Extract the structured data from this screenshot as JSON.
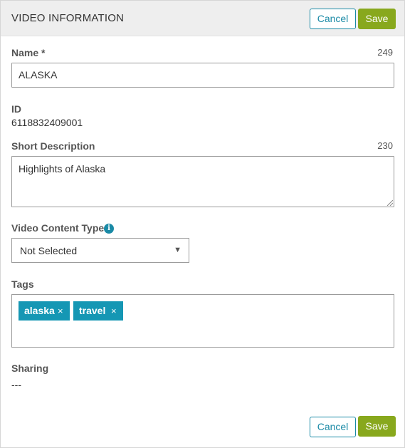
{
  "header": {
    "title": "VIDEO INFORMATION",
    "cancel_label": "Cancel",
    "save_label": "Save"
  },
  "fields": {
    "name": {
      "label": "Name *",
      "counter": "249",
      "value": "ALASKA"
    },
    "id": {
      "label": "ID",
      "value": "6118832409001"
    },
    "short_description": {
      "label": "Short Description",
      "counter": "230",
      "value": "Highlights of Alaska"
    },
    "video_content_type": {
      "label": "Video Content Type",
      "info_icon": "info-icon",
      "selected": "Not Selected",
      "arrow": "▼"
    },
    "tags": {
      "label": "Tags",
      "items": [
        {
          "label": "alaska",
          "remove": "×"
        },
        {
          "label": "travel",
          "remove": "×"
        }
      ]
    },
    "sharing": {
      "label": "Sharing",
      "value": "---"
    }
  },
  "footer": {
    "cancel_label": "Cancel",
    "save_label": "Save"
  },
  "colors": {
    "accent": "#1a8aa6",
    "save": "#88a81d",
    "tag": "#1597b4",
    "header_bg": "#eeeeee"
  }
}
